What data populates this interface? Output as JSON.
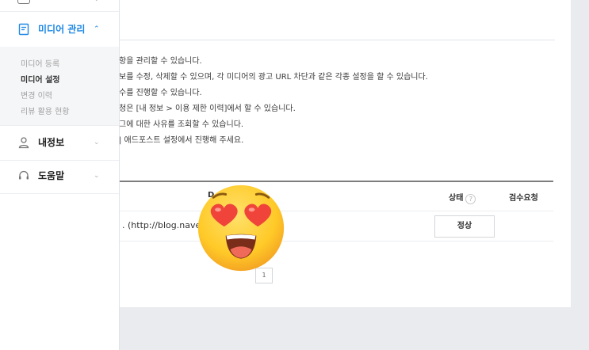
{
  "sidebar": {
    "media_menu": {
      "label": "미디어 관리",
      "icon": "document-icon",
      "expanded": true
    },
    "submenu": [
      {
        "label": "미디어 등록",
        "active": false
      },
      {
        "label": "미디어 설정",
        "active": true
      },
      {
        "label": "변경 이력",
        "active": false
      },
      {
        "label": "리뷰 활용 현황",
        "active": false
      }
    ],
    "profile_menu": {
      "label": "내정보",
      "icon": "person-icon"
    },
    "help_menu": {
      "label": "도움말",
      "icon": "headset-icon"
    }
  },
  "main": {
    "notes": [
      "항을 관리할 수 있습니다.",
      "보를 수정, 삭제할 수 있으며, 각 미디어의 광고 URL 차단과 같은 각종 설정을 할 수 있습니다.",
      "수를 진행할 수 있습니다.",
      "청은 [내 정보 > 이용 제한 이력]에서 할 수 있습니다.",
      "그에 대한 사유를 조회할 수 있습니다.",
      "| 애드포스트 설정에서 진행해 주세요."
    ],
    "table": {
      "headers": {
        "col_d": "D",
        "status": "상태",
        "review": "검수요청"
      },
      "help_glyph": "?",
      "row": {
        "url": ". (http://blog.naver.c",
        "status": "정상"
      }
    },
    "pagination": {
      "current_page": "1"
    }
  },
  "colors": {
    "accent": "#1e88e5",
    "background": "#e9ebee",
    "emoji_face": "#ffca28",
    "emoji_heart": "#f0443a"
  }
}
